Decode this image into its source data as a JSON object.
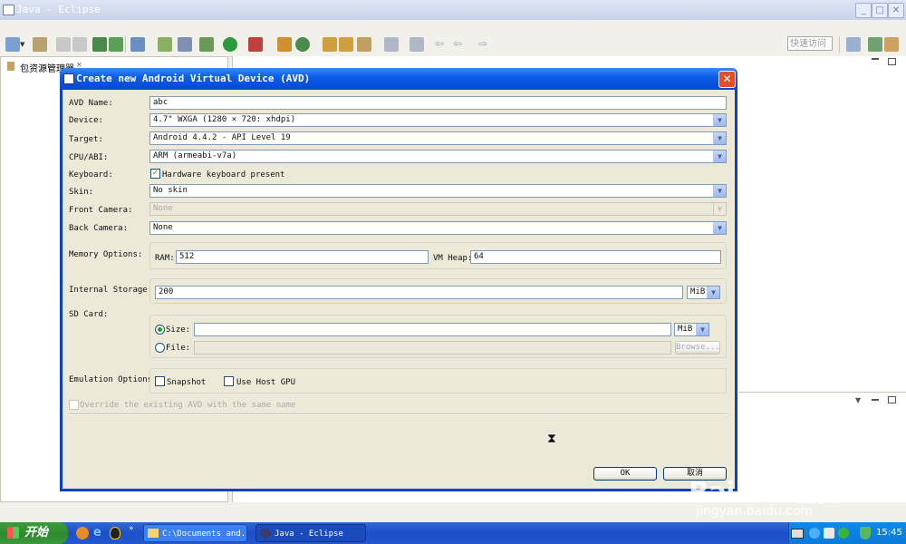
{
  "window": {
    "title": "Java - Eclipse"
  },
  "toolbar": {
    "quick_access_placeholder": "快速访问"
  },
  "package_explorer": {
    "tab_label": "包资源管理器"
  },
  "dialog": {
    "title": "Create new Android Virtual Device (AVD)",
    "avd_name": {
      "label": "AVD Name:",
      "value": "abc"
    },
    "device": {
      "label": "Device:",
      "value": "4.7\" WXGA (1280 × 720: xhdpi)"
    },
    "target": {
      "label": "Target:",
      "value": "Android 4.4.2 - API Level 19"
    },
    "cpu_abi": {
      "label": "CPU/ABI:",
      "value": "ARM (armeabi-v7a)"
    },
    "keyboard": {
      "label": "Keyboard:",
      "checkbox_label": "Hardware keyboard present",
      "checked": true
    },
    "skin": {
      "label": "Skin:",
      "value": "No skin"
    },
    "front_camera": {
      "label": "Front Camera:",
      "value": "None"
    },
    "back_camera": {
      "label": "Back Camera:",
      "value": "None"
    },
    "memory": {
      "label": "Memory Options:",
      "ram_label": "RAM:",
      "ram_value": "512",
      "heap_label": "VM Heap:",
      "heap_value": "64"
    },
    "internal_storage": {
      "label": "Internal Storage:",
      "value": "200",
      "unit": "MiB"
    },
    "sd_card": {
      "label": "SD Card:",
      "size_label": "Size:",
      "size_value": "",
      "size_unit": "MiB",
      "file_label": "File:",
      "file_value": "",
      "browse_label": "Browse..."
    },
    "emulation": {
      "label": "Emulation Options:",
      "snapshot_label": "Snapshot",
      "host_gpu_label": "Use Host GPU"
    },
    "override_label": "Override the existing AVD with the same name",
    "ok_label": "OK",
    "cancel_label": "取消"
  },
  "taskbar": {
    "start_label": "开始",
    "tasks": [
      "C:\\Documents and...",
      "Java - Eclipse"
    ],
    "clock": "15:45"
  },
  "watermark": {
    "brand": "Bai du 经验",
    "url": "jingyan.baidu.com"
  }
}
